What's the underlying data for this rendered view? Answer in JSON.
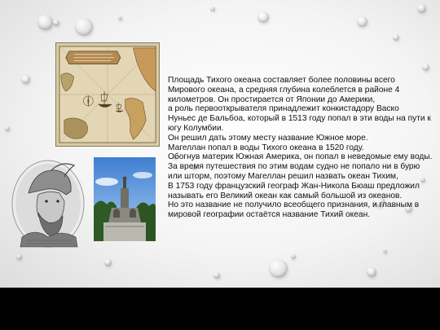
{
  "slide": {
    "paragraphs": [
      "Площадь Тихого океана составляет более половины всего",
      "Мирового океана, а средняя глубина колеблется в районе 4",
      "километров. Он простирается от Японии до Америки,",
      "а роль первооткрывателя принадлежит конкистадору Васко",
      "Нуньес де Бальбоа, который в 1513 году попал в эти воды на пути к",
      "югу Колумбии.",
      "Он решил дать этому месту название Южное море.",
      "Магеллан попал в воды Тихого океана в 1520 году.",
      "Обогнув материк Южная Америка, он попал в неведомые ему воды.",
      "За время путешествия по этим водам судно не попало ни в бурю",
      "или шторм, поэтому Магеллан решил назвать океан Тихим,",
      "В 1753 году французский географ Жан-Никола Бюаш предложил",
      "называть его Великий океан как самый большой из океанов.",
      "Но это название не получило всеобщего признания, и главным в",
      "мировой географии остаётся название Тихий океан."
    ]
  },
  "images": {
    "map": "old-pacific-map-image",
    "portrait": "explorer-portrait-engraving",
    "statue": "monument-statue-photo"
  },
  "colors": {
    "background": "#f4f4f4",
    "text": "#111111",
    "bar": "#000000"
  }
}
